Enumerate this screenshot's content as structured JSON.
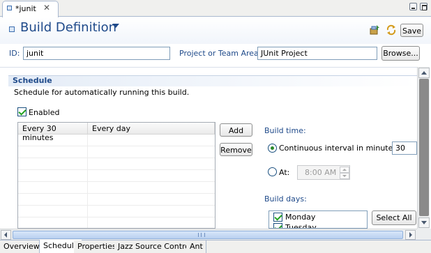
{
  "tab": {
    "title": "*junit",
    "close_glyph": "✕"
  },
  "header": {
    "title": "Build Definition",
    "save_label": "Save"
  },
  "id_row": {
    "id_label": "ID:",
    "id_value": "junit",
    "area_label": "Project or Team Area:",
    "area_value": "JUnit Project",
    "browse_label": "Browse..."
  },
  "schedule": {
    "title": "Schedule",
    "description": "Schedule for automatically running this build.",
    "enabled_label": "Enabled",
    "enabled": true,
    "table": {
      "columns": [
        "Every 30 minutes",
        "Every day"
      ]
    },
    "add_label": "Add",
    "remove_label": "Remove",
    "build_time_label": "Build time:",
    "continuous_label": "Continuous interval in minutes:",
    "continuous_selected": true,
    "interval_value": "30",
    "at_label": "At:",
    "at_value": "8:00 AM",
    "build_days_label": "Build days:",
    "days": [
      {
        "label": "Monday",
        "checked": true
      },
      {
        "label": "Tuesday",
        "checked": true
      }
    ],
    "select_all_label": "Select All"
  },
  "page_tabs": [
    {
      "label": "Overview",
      "active": false
    },
    {
      "label": "Schedule",
      "active": true
    },
    {
      "label": "Properties",
      "active": false
    },
    {
      "label": "Jazz Source Control",
      "active": false
    },
    {
      "label": "Ant",
      "active": false
    }
  ],
  "colors": {
    "title_blue": "#1f4a8a",
    "accent_green": "#21a121"
  }
}
